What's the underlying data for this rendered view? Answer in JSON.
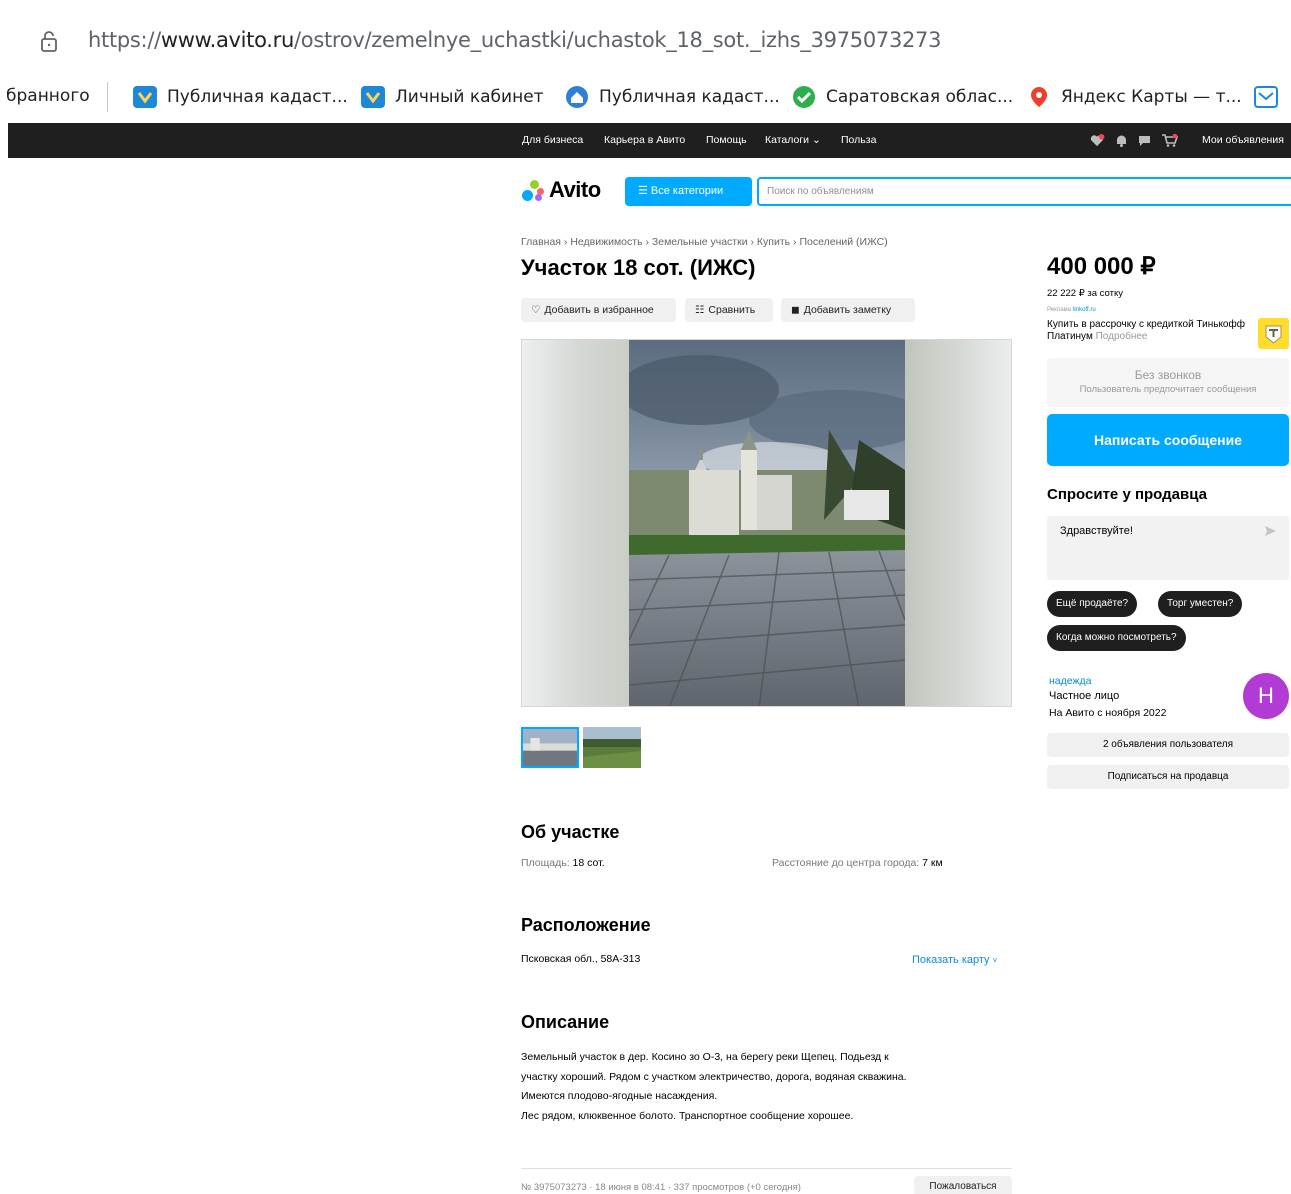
{
  "browser": {
    "url_prefix": "https://",
    "url_domain": "www.avito.ru",
    "url_path": "/ostrov/zemelnye_uchastki/uchastok_18_sot._izhs_3975073273",
    "bookmarks": [
      {
        "label": "бранного",
        "icon": "none"
      },
      {
        "label": "Публичная кадаст...",
        "icon": "kadastr-icon"
      },
      {
        "label": "Личный кабинет",
        "icon": "kadastr-icon"
      },
      {
        "label": "Публичная кадаст...",
        "icon": "globe-home-icon"
      },
      {
        "label": "Саратовская облас...",
        "icon": "check-circle-icon"
      },
      {
        "label": "Яндекс Карты — т...",
        "icon": "map-pin-icon"
      }
    ]
  },
  "topbar": {
    "links": [
      "Для бизнеса",
      "Карьера в Авито",
      "Помощь",
      "Каталоги",
      "Польза"
    ],
    "my_ads": "Мои объявления"
  },
  "header": {
    "logo_text": "Avito",
    "categories_button": "Все категории",
    "search_placeholder": "Поиск по объявлениям"
  },
  "breadcrumb": [
    "Главная",
    "Недвижимость",
    "Земельные участки",
    "Купить",
    "Поселений (ИЖС)"
  ],
  "listing": {
    "title": "Участок 18 сот. (ИЖС)",
    "actions": {
      "favorite": "Добавить в избранное",
      "compare": "Сравнить",
      "note": "Добавить заметку"
    },
    "about_heading": "Об участке",
    "params": [
      {
        "label": "Площадь:",
        "value": "18 сот."
      },
      {
        "label": "Расстояние до центра города:",
        "value": "7 км"
      }
    ],
    "location_heading": "Расположение",
    "address": "Псковская обл., 58А-313",
    "show_map": "Показать карту",
    "description_heading": "Описание",
    "description_lines": [
      "Земельный участок в дер. Косино зо О-3, на берегу реки Щепец. Подьезд к",
      "участку хороший. Рядом с участком электричество, дорога, водяная скважина.",
      "Имеются плодово-ягодные насаждения.",
      "Лес рядом, клюквенное болото. Транспортное сообщение хорошее."
    ],
    "meta": "№ 3975073273 · 18 июня в 08:41 · 337 просмотров (+0 сегодня)",
    "complain": "Пожаловаться"
  },
  "sidebar": {
    "price": "400 000 ₽",
    "price_per_unit": "22 222 ₽ за сотку",
    "ad_label": "Реклама",
    "ad_source": "tinkoff.ru",
    "ad_text": "Купить в рассрочку с кредиткой Тинькофф Платинум",
    "ad_more": "Подробнее",
    "no_calls_title": "Без звонков",
    "no_calls_sub": "Пользователь предпочитает сообщения",
    "write_button": "Написать сообщение",
    "ask_heading": "Спросите у продавца",
    "ask_value": "Здравствуйте!",
    "chips": [
      "Ещё продаёте?",
      "Торг уместен?",
      "Когда можно посмотреть?"
    ],
    "seller_name": "надежда",
    "seller_type": "Частное лицо",
    "seller_since": "На Авито с ноября 2022",
    "avatar_letter": "Н",
    "seller_ads": "2 объявления пользователя",
    "subscribe": "Подписаться на продавца"
  },
  "colors": {
    "accent": "#00aaff",
    "topbar": "#1f1f1f",
    "avatar": "#b23bd6",
    "link": "#0a8ad8"
  }
}
